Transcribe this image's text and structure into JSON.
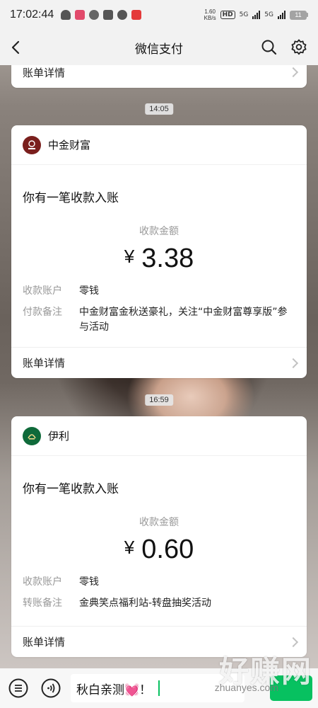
{
  "status_bar": {
    "time": "17:02:44",
    "net_speed_value": "1.60",
    "net_speed_unit": "KB/s",
    "hd_badge": "HD",
    "sim1": "5G",
    "sim2": "5G",
    "battery": "11"
  },
  "nav": {
    "title": "微信支付"
  },
  "cards": [
    {
      "detail_label": "账单详情"
    },
    {
      "time": "14:05",
      "merchant": "中金财富",
      "notice": "你有一笔收款入账",
      "amount_label": "收款金额",
      "currency": "¥",
      "amount": "3.38",
      "rows": [
        {
          "key": "收款账户",
          "value": "零钱"
        },
        {
          "key": "付款备注",
          "value": "中金财富金秋送豪礼，关注“中金财富尊享版”参与活动"
        }
      ],
      "detail_label": "账单详情"
    },
    {
      "time": "16:59",
      "merchant": "伊利",
      "notice": "你有一笔收款入账",
      "amount_label": "收款金额",
      "currency": "¥",
      "amount": "0.60",
      "rows": [
        {
          "key": "收款账户",
          "value": "零钱"
        },
        {
          "key": "转账备注",
          "value": "金典笑点福利站-转盘抽奖活动"
        }
      ],
      "detail_label": "账单详情"
    }
  ],
  "input": {
    "text": "秋白亲测💓！"
  },
  "watermark": {
    "text": "好赚网",
    "url": "zhuanyes.com"
  },
  "colors": {
    "accent": "#07c160",
    "card_bg": "#ffffff",
    "muted_text": "#999999"
  }
}
